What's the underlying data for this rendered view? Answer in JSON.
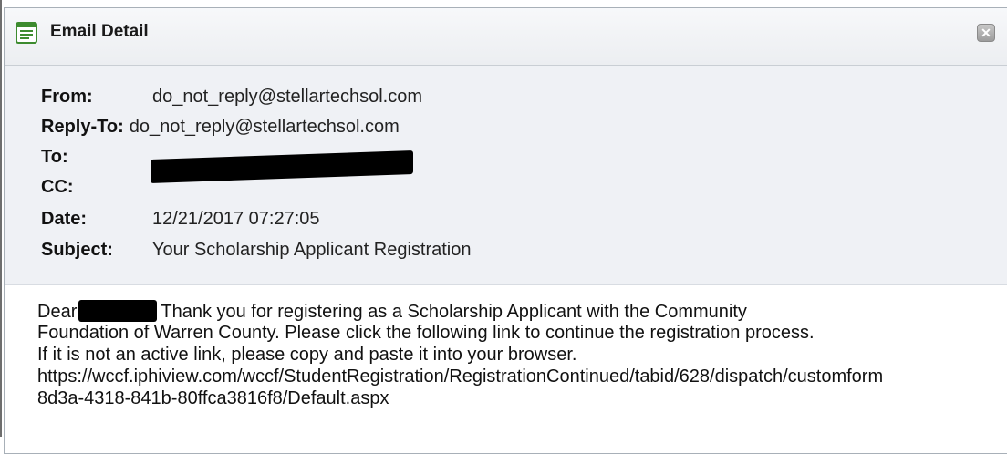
{
  "window": {
    "title": "Email Detail",
    "close_label": "✕"
  },
  "headers": {
    "from_label": "From:",
    "from_value": "do_not_reply@stellartechsol.com",
    "reply_to_label": "Reply-To:",
    "reply_to_value": "do_not_reply@stellartechsol.com",
    "to_label": "To:",
    "cc_label": "CC:",
    "date_label": "Date:",
    "date_value": "12/21/2017 07:27:05",
    "subject_label": "Subject:",
    "subject_value": "Your Scholarship Applicant Registration"
  },
  "body": {
    "greeting": "Dear",
    "line1_rest": "Thank you for registering as a Scholarship Applicant with the Community",
    "line2": "Foundation of Warren County. Please click the following link to continue the registration process.",
    "line3": "If it is not an active link, please copy and paste it into your browser.",
    "line4": "https://wccf.iphiview.com/wccf/StudentRegistration/RegistrationContinued/tabid/628/dispatch/customform",
    "line5": "8d3a-4318-841b-80ffca3816f8/Default.aspx"
  },
  "colors": {
    "header_bg": "#eff1f5",
    "titlebar_bg": "#eceef1",
    "icon_green": "#3d8b2f"
  }
}
